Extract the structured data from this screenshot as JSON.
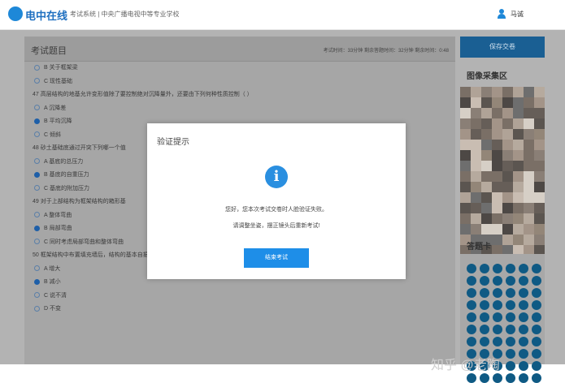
{
  "header": {
    "logo_text": "电中在线",
    "nav_text": "考试系统 | 中央广播电视中等专业学校",
    "user_name": "马诚"
  },
  "panel": {
    "title": "考试题目",
    "meta": "考试时间：33分钟    剩余答题时间：32分钟    剩余时间：0:48"
  },
  "questions": [
    {
      "kind": "opt",
      "selected": false,
      "text": "B 关于框架梁"
    },
    {
      "kind": "opt",
      "selected": false,
      "text": "C 现性基础"
    },
    {
      "kind": "q",
      "selected": false,
      "text": "47 高层结构的地基允许变形值除了要控制绝对沉降量外，还要由下列何种性质控制（ ）"
    },
    {
      "kind": "opt",
      "selected": false,
      "text": "A 沉降差"
    },
    {
      "kind": "opt",
      "selected": true,
      "text": "B 平均沉降"
    },
    {
      "kind": "opt",
      "selected": false,
      "text": "C 倾斜"
    },
    {
      "kind": "q",
      "selected": false,
      "text": "48 砂土基础底通过开突下列哪一个值"
    },
    {
      "kind": "opt",
      "selected": false,
      "text": "A 基底的总压力"
    },
    {
      "kind": "opt",
      "selected": true,
      "text": "B 基底的自重压力"
    },
    {
      "kind": "opt",
      "selected": false,
      "text": "C 基底的附加压力"
    },
    {
      "kind": "q",
      "selected": false,
      "text": "49 对于上部结构为框架结构的箱形基"
    },
    {
      "kind": "opt",
      "selected": false,
      "text": "A 整体弯曲"
    },
    {
      "kind": "opt",
      "selected": true,
      "text": "B 局部弯曲"
    },
    {
      "kind": "opt",
      "selected": false,
      "text": "C 同时考虑局部弯曲和整体弯曲"
    },
    {
      "kind": "q",
      "selected": false,
      "text": "50 框架结构中布置填充墙后，结构的基本自振周期将（ ）"
    },
    {
      "kind": "opt",
      "selected": false,
      "text": "A 增大"
    },
    {
      "kind": "opt",
      "selected": true,
      "text": "B 减小"
    },
    {
      "kind": "opt",
      "selected": false,
      "text": "C 说不清"
    },
    {
      "kind": "opt",
      "selected": false,
      "text": "D 不变"
    }
  ],
  "side": {
    "save_label": "保存交卷",
    "capture_title": "图像采集区",
    "card_title": "答题卡"
  },
  "modal": {
    "title": "验证提示",
    "icon": "info-icon",
    "icon_glyph": "i",
    "line1": "您好，您本次考试交卷时人脸验证失败。",
    "line2": "请调整坐姿，摆正镜头后重新考试!",
    "end_button": "结束考试"
  },
  "watermark": "知乎 @老陶",
  "colors": {
    "accent": "#1e8ee8",
    "dialog_bg": "#ffffff",
    "answer_card_dot": "#0f5a84"
  }
}
